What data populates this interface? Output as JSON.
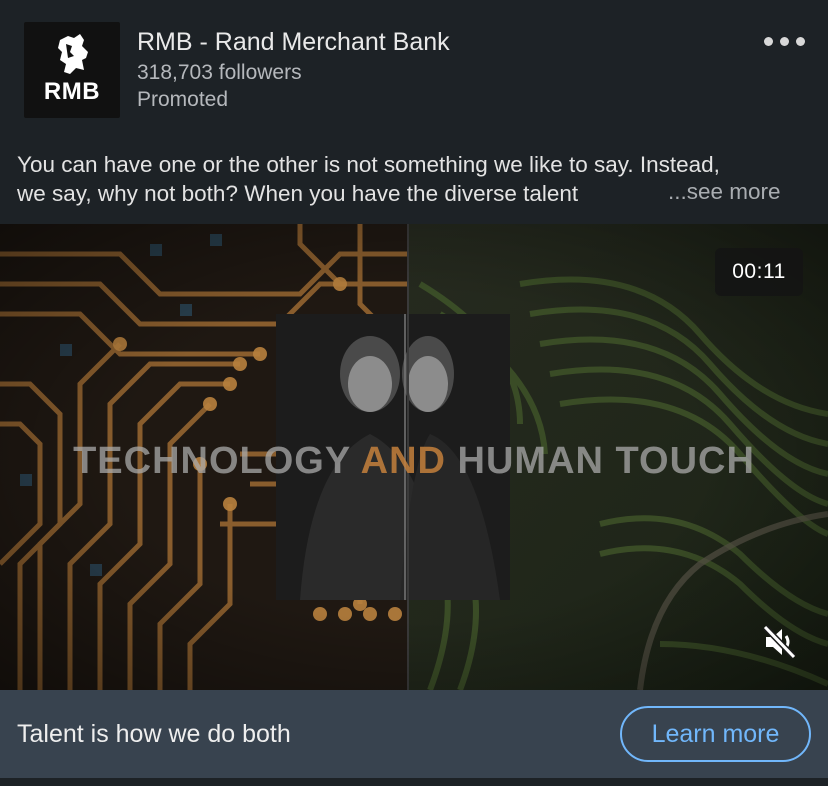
{
  "post": {
    "company_name": "RMB - Rand Merchant Bank",
    "followers": "318,703 followers",
    "promoted": "Promoted",
    "logo_text": "RMB",
    "more_icon": "ellipsis-horizontal-icon",
    "text_line1": "You can have one or the other is not something we like to say. Instead,",
    "text_line2": "we say, why not both? When you have the diverse talent",
    "see_more": "...see more"
  },
  "video": {
    "duration": "00:11",
    "headline_part1": "TECHNOLOGY ",
    "headline_part2": "AND",
    "headline_part3": " HUMAN TOUCH",
    "mute_icon": "speaker-muted-icon",
    "colors": {
      "accent": "#c4803c",
      "circuit": "#b07a3a",
      "field": "#2e3a22"
    }
  },
  "cta": {
    "headline": "Talent is how we do both",
    "button_label": "Learn more",
    "button_color": "#71b7fb",
    "bar_color": "#38434f"
  }
}
